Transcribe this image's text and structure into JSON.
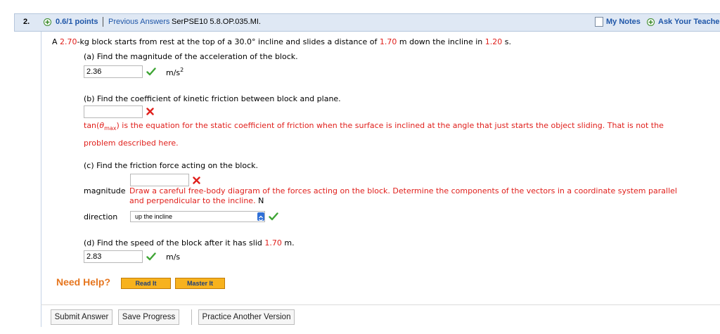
{
  "header": {
    "question_number": "2.",
    "points": "0.6/1 points",
    "previous_answers": "Previous Answers",
    "problem_code": "SerPSE10 5.8.OP.035.MI.",
    "my_notes": "My Notes",
    "ask_teacher": "Ask Your Teacher"
  },
  "statement": {
    "p1": "A ",
    "mass": "2.70",
    "p2": "-kg block starts from rest at the top of a 30.0° incline and slides a distance of ",
    "distance": "1.70",
    "p3": " m down the incline in ",
    "time": "1.20",
    "p4": " s."
  },
  "part_a": {
    "prompt": "(a) Find the magnitude of the acceleration of the block.",
    "answer": "2.36",
    "unit_base": "m/s",
    "unit_exp": "2",
    "status": "correct"
  },
  "part_b": {
    "prompt": "(b) Find the coefficient of kinetic friction between block and plane.",
    "answer": "",
    "status": "incorrect",
    "feedback_pre": "tan(",
    "feedback_theta": "θ",
    "feedback_sub": "max",
    "feedback_post": ") is the equation for the static coefficient of friction when the surface is inclined at the angle that just starts the object sliding. That is not the",
    "feedback_line2": "problem described here."
  },
  "part_c": {
    "prompt": "(c) Find the friction force acting on the block.",
    "magnitude_label": "magnitude",
    "magnitude_answer": "",
    "magnitude_status": "incorrect",
    "feedback_line1": "Draw a careful free-body diagram of the forces acting on the block. Determine the components of the vectors in a coordinate system parallel",
    "feedback_line2": "and perpendicular to the incline.",
    "magnitude_unit": "N",
    "direction_label": "direction",
    "direction_value": "up the incline",
    "direction_status": "correct"
  },
  "part_d": {
    "prompt_pre": "(d) Find the speed of the block after it has slid ",
    "prompt_value": "1.70",
    "prompt_post": " m.",
    "answer": "2.83",
    "unit": "m/s",
    "status": "correct"
  },
  "help": {
    "label": "Need Help?",
    "read_it": "Read It",
    "master_it": "Master It"
  },
  "footer": {
    "submit": "Submit Answer",
    "save": "Save Progress",
    "practice": "Practice Another Version"
  },
  "colors": {
    "header_bg": "#dfe8f4",
    "link_blue": "#1f56a8",
    "error_red": "#e0201c",
    "check_green": "#3fa535",
    "help_orange": "#e6761f",
    "help_button": "#f7b21e"
  }
}
